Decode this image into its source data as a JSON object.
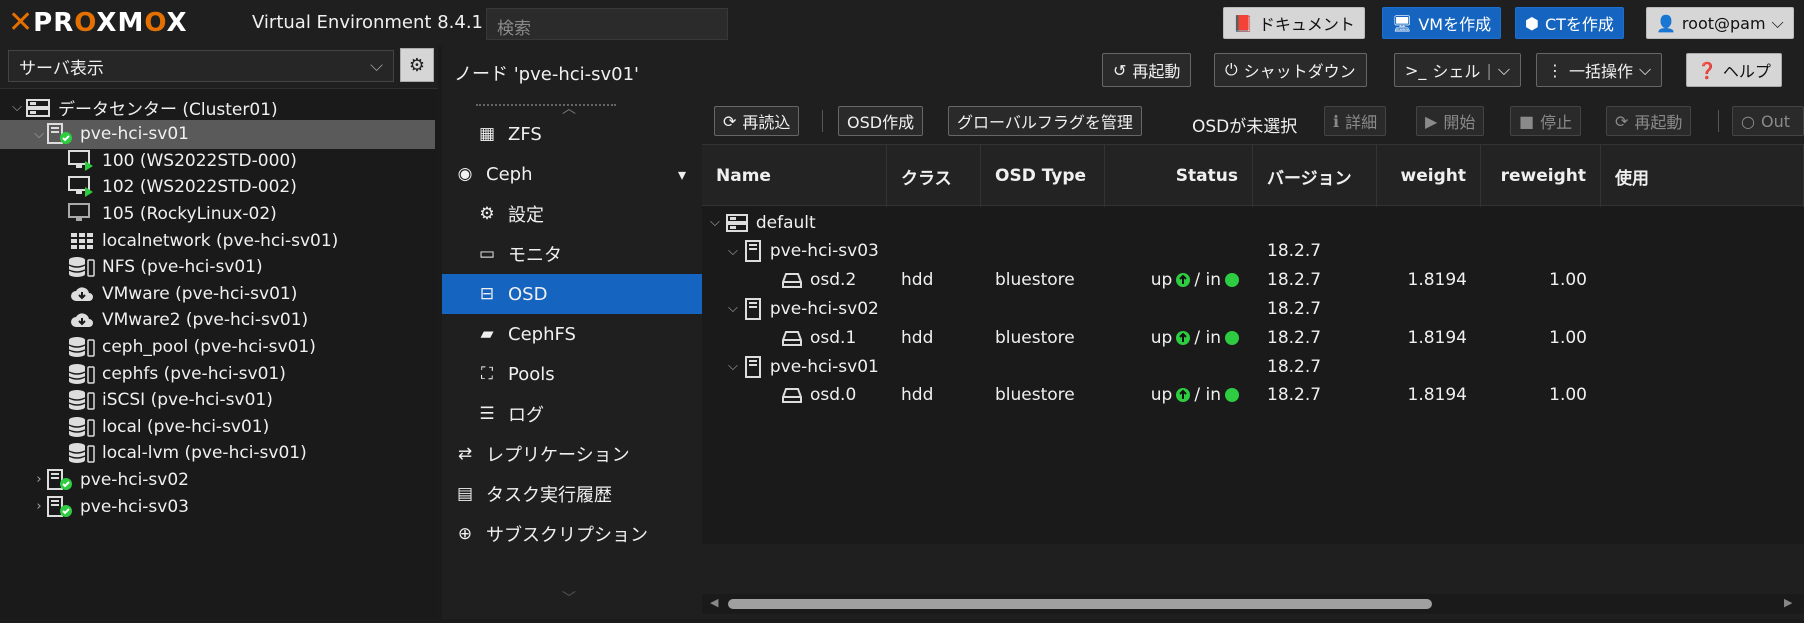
{
  "topbar": {
    "logo": "PROXMOX",
    "version": "Virtual Environment 8.4.1",
    "search_placeholder": "検索",
    "docs": "ドキュメント",
    "create_vm": "VMを作成",
    "create_ct": "CTを作成",
    "user": "root@pam"
  },
  "sidebar": {
    "view": "サーバ表示",
    "tree": [
      {
        "label": "データセンター (Cluster01)",
        "icon": "datacenter-icon",
        "level": 0,
        "caret": "expanded"
      },
      {
        "label": "pve-hci-sv01",
        "icon": "node-icon",
        "level": 1,
        "caret": "expanded",
        "selected": true
      },
      {
        "label": "100 (WS2022STD-000)",
        "icon": "vm-running-icon",
        "level": 2
      },
      {
        "label": "102 (WS2022STD-002)",
        "icon": "vm-running-icon",
        "level": 2
      },
      {
        "label": "105 (RockyLinux-02)",
        "icon": "vm-stopped-icon",
        "level": 2
      },
      {
        "label": "localnetwork (pve-hci-sv01)",
        "icon": "sdn-icon",
        "level": 2
      },
      {
        "label": "NFS (pve-hci-sv01)",
        "icon": "storage-icon",
        "level": 2
      },
      {
        "label": "VMware (pve-hci-sv01)",
        "icon": "cloud-icon",
        "level": 2
      },
      {
        "label": "VMware2 (pve-hci-sv01)",
        "icon": "cloud-icon",
        "level": 2
      },
      {
        "label": "ceph_pool (pve-hci-sv01)",
        "icon": "storage-icon",
        "level": 2
      },
      {
        "label": "cephfs (pve-hci-sv01)",
        "icon": "storage-icon",
        "level": 2
      },
      {
        "label": "iSCSI (pve-hci-sv01)",
        "icon": "storage-icon",
        "level": 2
      },
      {
        "label": "local (pve-hci-sv01)",
        "icon": "storage-icon",
        "level": 2
      },
      {
        "label": "local-lvm (pve-hci-sv01)",
        "icon": "storage-icon",
        "level": 2
      },
      {
        "label": "pve-hci-sv02",
        "icon": "node-icon",
        "level": 1,
        "caret": "collapsed"
      },
      {
        "label": "pve-hci-sv03",
        "icon": "node-icon",
        "level": 1,
        "caret": "collapsed"
      }
    ]
  },
  "nodeheader": {
    "title": "ノード 'pve-hci-sv01'",
    "reboot": "再起動",
    "shutdown": "シャットダウン",
    "shell": "シェル",
    "bulk": "一括操作",
    "help": "ヘルプ"
  },
  "menu": {
    "items": [
      {
        "label": "ZFS",
        "icon": "grid-icon",
        "sub": true
      },
      {
        "label": "Ceph",
        "icon": "ceph-icon",
        "sub": false,
        "caret": true
      },
      {
        "label": "設定",
        "icon": "gear-icon",
        "sub": true
      },
      {
        "label": "モニタ",
        "icon": "monitor-icon",
        "sub": true
      },
      {
        "label": "OSD",
        "icon": "hdd-icon",
        "sub": true,
        "active": true
      },
      {
        "label": "CephFS",
        "icon": "folder-icon",
        "sub": true
      },
      {
        "label": "Pools",
        "icon": "sitemap-icon",
        "sub": true
      },
      {
        "label": "ログ",
        "icon": "list-icon",
        "sub": true
      },
      {
        "label": "レプリケーション",
        "icon": "retweet-icon",
        "sub": false
      },
      {
        "label": "タスク実行履歴",
        "icon": "tasks-icon",
        "sub": false
      },
      {
        "label": "サブスクリプション",
        "icon": "support-icon",
        "sub": false
      }
    ]
  },
  "toolbar": {
    "reload": "再読込",
    "create_osd": "OSD作成",
    "flags": "グローバルフラグを管理",
    "no_selection": "OSDが未選択",
    "details": "詳細",
    "start": "開始",
    "stop": "停止",
    "restart": "再起動",
    "out": "Out"
  },
  "grid": {
    "columns": [
      "Name",
      "クラス",
      "OSD Type",
      "Status",
      "バージョン",
      "weight",
      "reweight",
      "使用"
    ],
    "rows": [
      {
        "type": "root",
        "name": "default"
      },
      {
        "type": "host",
        "name": "pve-hci-sv03",
        "version": "18.2.7"
      },
      {
        "type": "osd",
        "name": "osd.2",
        "class": "hdd",
        "osd_type": "bluestore",
        "status_up": "up",
        "status_in": "/ in",
        "version": "18.2.7",
        "weight": "1.8194",
        "reweight": "1.00"
      },
      {
        "type": "host",
        "name": "pve-hci-sv02",
        "version": "18.2.7"
      },
      {
        "type": "osd",
        "name": "osd.1",
        "class": "hdd",
        "osd_type": "bluestore",
        "status_up": "up",
        "status_in": "/ in",
        "version": "18.2.7",
        "weight": "1.8194",
        "reweight": "1.00"
      },
      {
        "type": "host",
        "name": "pve-hci-sv01",
        "version": "18.2.7"
      },
      {
        "type": "osd",
        "name": "osd.0",
        "class": "hdd",
        "osd_type": "bluestore",
        "status_up": "up",
        "status_in": "/ in",
        "version": "18.2.7",
        "weight": "1.8194",
        "reweight": "1.00"
      }
    ]
  },
  "colors": {
    "accent": "#1565c0",
    "brand": "#e57000",
    "status_ok": "#2ecc40"
  }
}
